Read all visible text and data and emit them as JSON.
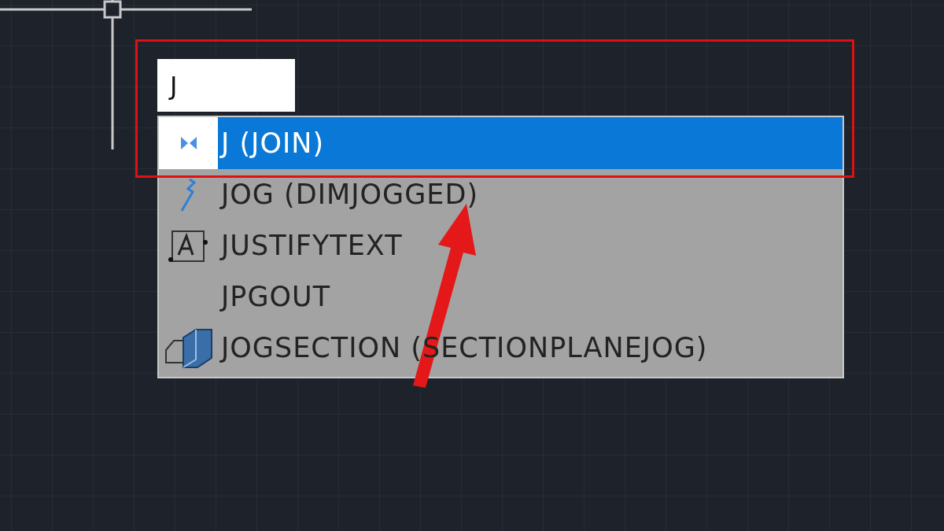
{
  "command_input": {
    "value": "J"
  },
  "suggestions": [
    {
      "label": "J (JOIN)",
      "kind": "join",
      "selected": true
    },
    {
      "label": "JOG (DIMJOGGED)",
      "kind": "dimjogged",
      "selected": false
    },
    {
      "label": "JUSTIFYTEXT",
      "kind": "justifytext",
      "selected": false
    },
    {
      "label": "JPGOUT",
      "kind": "none",
      "selected": false
    },
    {
      "label": "JOGSECTION (SECTIONPLANEJOG)",
      "kind": "jogsection",
      "selected": false
    }
  ]
}
